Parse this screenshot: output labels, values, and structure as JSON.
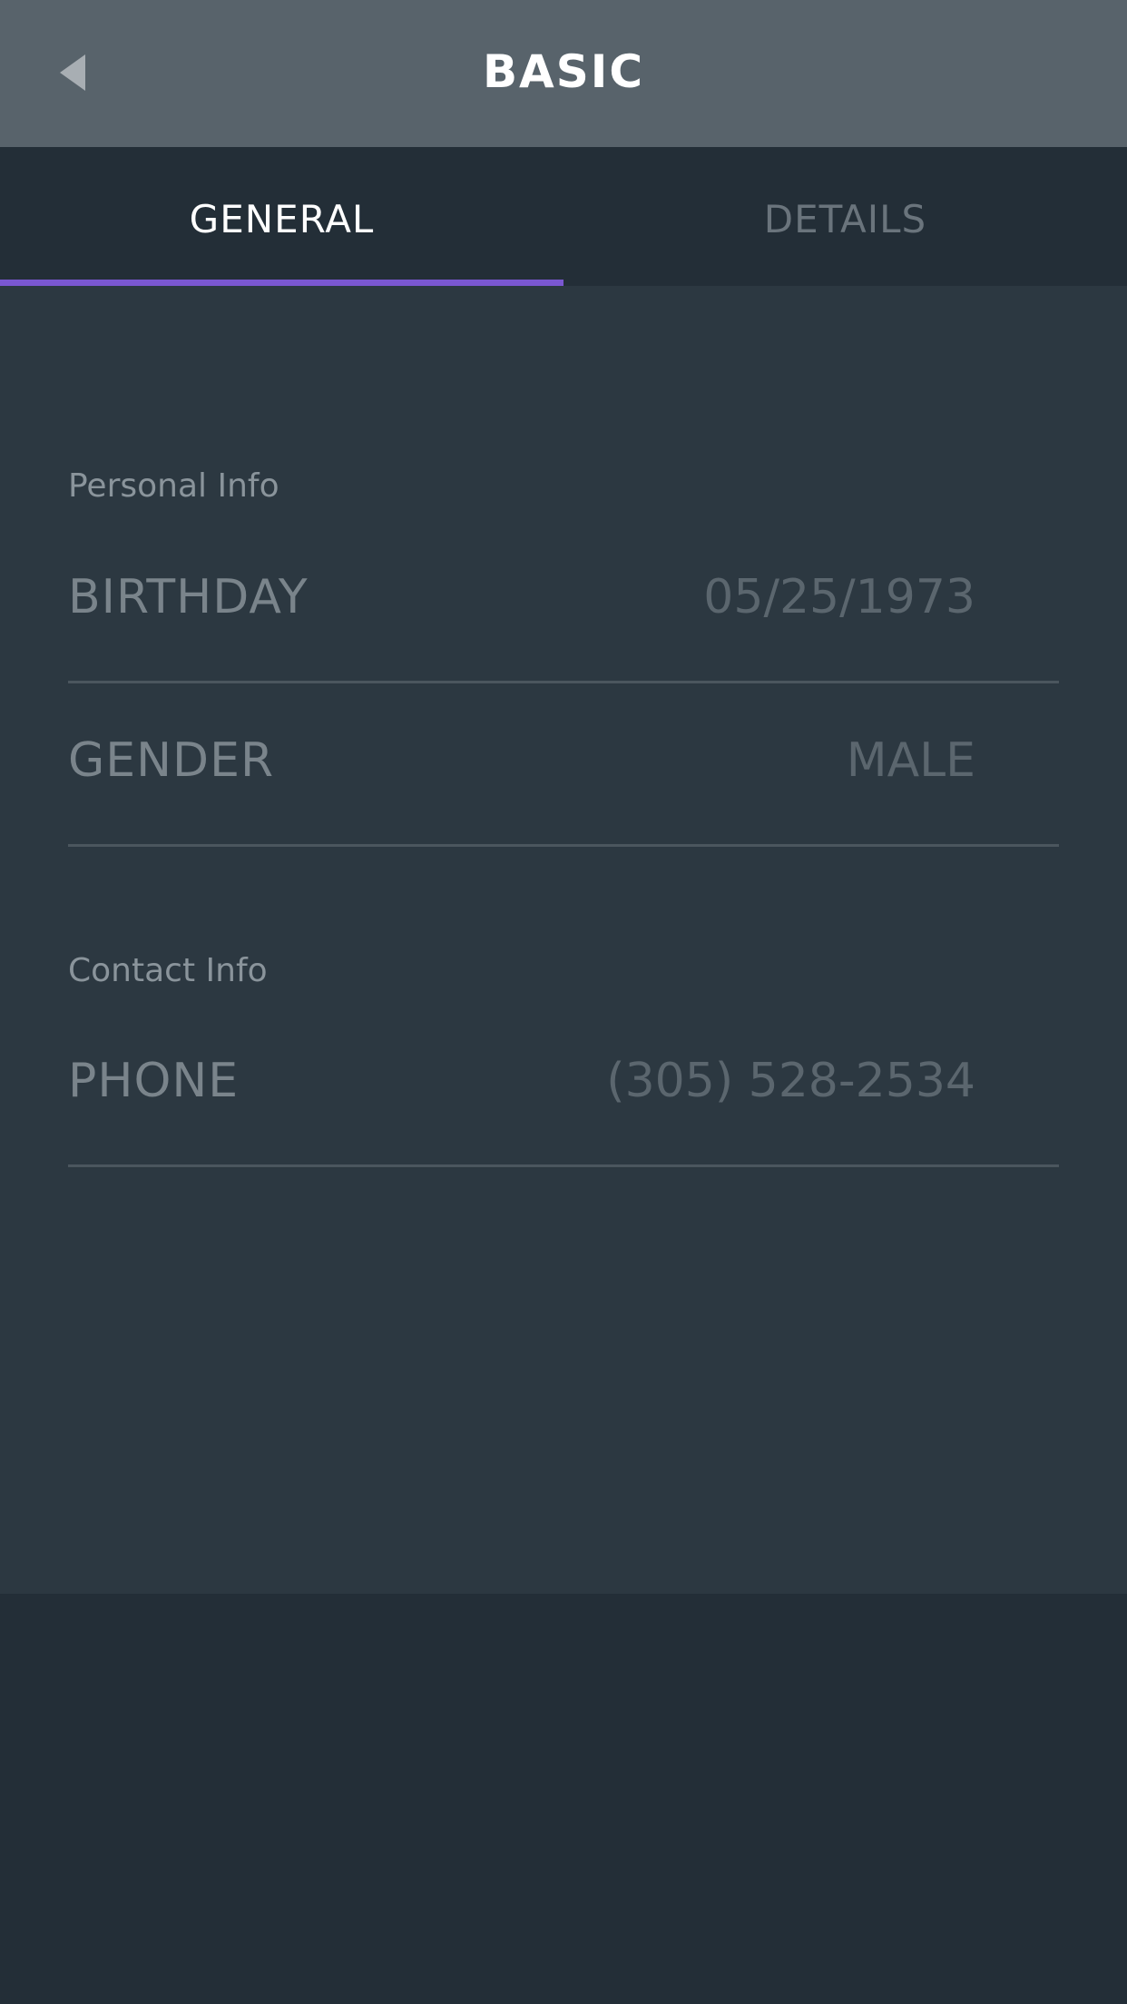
{
  "header": {
    "title": "BASIC",
    "back_icon": "back-arrow-icon"
  },
  "tabs": [
    {
      "label": "GENERAL",
      "active": true
    },
    {
      "label": "DETAILS",
      "active": false
    }
  ],
  "sections": [
    {
      "label": "Personal Info",
      "rows": [
        {
          "label": "BIRTHDAY",
          "value": "05/25/1973"
        },
        {
          "label": "GENDER",
          "value": "MALE"
        }
      ]
    },
    {
      "label": "Contact Info",
      "rows": [
        {
          "label": "PHONE",
          "value": "(305) 528-2534"
        }
      ]
    }
  ],
  "colors": {
    "accent": "#7a57d1",
    "header_bg": "#58636b",
    "tab_bg": "#232e37",
    "content_bg": "#2c3841"
  }
}
